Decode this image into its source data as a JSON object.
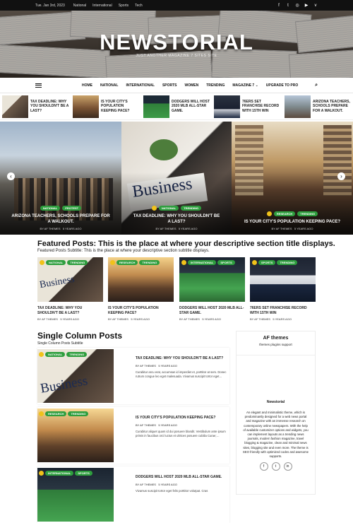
{
  "topbar": {
    "date": "Tue. Jan 3rd, 2023",
    "links": [
      "National",
      "International",
      "Sports",
      "Tech"
    ]
  },
  "site": {
    "title": "NEWSTORIAL",
    "tagline": "JUST ANOTHER MAGAZINE 7 SITES SITE"
  },
  "nav": {
    "items": [
      "HOME",
      "NATIONAL",
      "INTERNATIONAL",
      "SPORTS",
      "WOMEN",
      "TRENDING",
      "MAGAZINE 7",
      "UPGRADE TO PRO"
    ]
  },
  "ticker": [
    "TAX DEADLINE: WHY YOU SHOULDN'T BE A LAST?",
    "IS YOUR CITY'S POPULATION KEEPING PACE?",
    "DODGERS WILL HOST 2020 MLB ALL-STAR GAME.",
    "76ERS SET FRANCHISE RECORD WITH 15TH WIN",
    "ARIZONA TEACHERS, SCHOOLS PREPARE FOR A WALKOUT."
  ],
  "slides": [
    {
      "tags": [
        "NATIONAL",
        "PROTEST"
      ],
      "title": "ARIZONA TEACHERS, SCHOOLS PREPARE FOR A WALKOUT.",
      "author": "BY AF THEMES",
      "date": "5 YEARS AGO"
    },
    {
      "tags": [
        "NATIONAL",
        "TRENDING"
      ],
      "title": "TAX DEADLINE: WHY YOU SHOULDN'T BE A LAST?",
      "author": "BY AF THEMES",
      "date": "5 YEARS AGO"
    },
    {
      "tags": [
        "RESEARCH",
        "TRENDING"
      ],
      "title": "IS YOUR CITY'S POPULATION KEEPING PACE?",
      "author": "BY AF THEMES",
      "date": "5 YEARS AGO"
    }
  ],
  "featured": {
    "title": "Featured Posts: This is the place at where your descriptive section title displays.",
    "subtitle": "Featured Posts Subtitle: This is the place at where your descriptive section subtitle displays.",
    "posts": [
      {
        "tags": [
          "NATIONAL",
          "TRENDING"
        ],
        "title": "TAX DEADLINE: WHY YOU SHOULDN'T BE A LAST?",
        "author": "BY AF THEMES",
        "date": "5 YEARS AGO"
      },
      {
        "tags": [
          "RESEARCH",
          "TRENDING"
        ],
        "title": "IS YOUR CITY'S POPULATION KEEPING PACE?",
        "author": "BY AF THEMES",
        "date": "5 YEARS AGO"
      },
      {
        "tags": [
          "INTERNATIONAL",
          "SPORTS"
        ],
        "title": "DODGERS WILL HOST 2020 MLB ALL-STAR GAME.",
        "author": "BY AF THEMES",
        "date": "5 YEARS AGO"
      },
      {
        "tags": [
          "SPORTS",
          "TRENDING"
        ],
        "title": "76ERS SET FRANCHISE RECORD WITH 15TH WIN",
        "author": "BY AF THEMES",
        "date": "5 YEARS AGO"
      }
    ]
  },
  "single": {
    "title": "Single Column Posts",
    "subtitle": "Single Column Posts Subtitle",
    "posts": [
      {
        "tags": [
          "NATIONAL",
          "TRENDING"
        ],
        "title": "TAX DEADLINE: WHY YOU SHOULDN'T BE A LAST?",
        "author": "BY AF THEMES",
        "date": "5 YEARS AGO",
        "excerpt": "Curabitur arcu erat, accumsan id imperdiet et, porttitor at sem. Donec rutrum congue leo eget malesuada. Vivamus suscipit tortor eget…"
      },
      {
        "tags": [
          "RESEARCH",
          "TRENDING"
        ],
        "title": "IS YOUR CITY'S POPULATION KEEPING PACE?",
        "author": "BY AF THEMES",
        "date": "5 YEARS AGO",
        "excerpt": "Curabitur aliquet quam id dui posuere blandit. Vestibulum ante ipsum primis in faucibus orci luctus et ultrices posuere cubilia Curae;…"
      },
      {
        "tags": [
          "INTERNATIONAL",
          "SPORTS"
        ],
        "title": "DODGERS WILL HOST 2020 MLB ALL-STAR GAME.",
        "author": "BY AF THEMES",
        "date": "5 YEARS AGO",
        "excerpt": "Vivamus suscipit tortor eget felis porttitor volutpat. Cras"
      }
    ]
  },
  "sidebar": {
    "heading": "AF themes",
    "sub": "themes plugins support",
    "name": "Newstorial",
    "desc": "An elegant and minimalistic theme, which is predominantly designed for a web news portal and magazine with an immense research on contemporary online newspapers. With the help of available customizer options and widgets, you can implement layouts as a trending news journals, modern fashion magazine, travel blogging & magazine, clean and minimal news sites, blogging site and even more. The theme is SEO friendly with optimized codes and awesome supports.",
    "social": [
      "f",
      "t",
      "in"
    ]
  }
}
